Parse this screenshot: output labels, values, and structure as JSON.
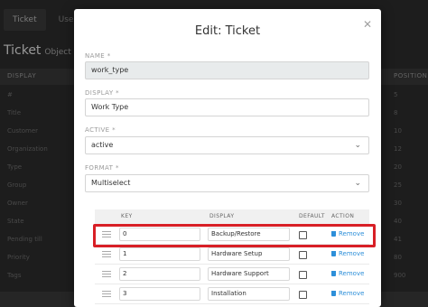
{
  "background": {
    "tabs": [
      "Ticket",
      "User"
    ],
    "title": "Ticket",
    "subtitle": "Object Man",
    "columns": {
      "display": "DISPLAY",
      "position": "POSITION"
    },
    "rows": [
      {
        "name": "#",
        "position": "5"
      },
      {
        "name": "Title",
        "position": "8"
      },
      {
        "name": "Customer",
        "position": "10"
      },
      {
        "name": "Organization",
        "position": "12"
      },
      {
        "name": "Type",
        "position": "20"
      },
      {
        "name": "Group",
        "position": "25"
      },
      {
        "name": "Owner",
        "position": "30"
      },
      {
        "name": "State",
        "position": "40"
      },
      {
        "name": "Pending till",
        "position": "41"
      },
      {
        "name": "Priority",
        "position": "80"
      },
      {
        "name": "Tags",
        "position": "900"
      }
    ]
  },
  "modal": {
    "title": "Edit: Ticket",
    "close_icon": "close-icon",
    "name": {
      "label": "NAME *",
      "value": "work_type"
    },
    "display": {
      "label": "DISPLAY *",
      "value": "Work Type"
    },
    "active": {
      "label": "ACTIVE *",
      "value": "active"
    },
    "format": {
      "label": "FORMAT *",
      "value": "Multiselect"
    },
    "table": {
      "headers": {
        "key": "KEY",
        "display": "DISPLAY",
        "default": "DEFAULT",
        "action": "ACTION"
      },
      "remove_label": "Remove",
      "rows": [
        {
          "key": "0",
          "display": "Backup/Restore"
        },
        {
          "key": "1",
          "display": "Hardware Setup"
        },
        {
          "key": "2",
          "display": "Hardware Support"
        },
        {
          "key": "3",
          "display": "Installation"
        }
      ]
    }
  },
  "colors": {
    "accent": "#2d8fd9",
    "highlight": "#d81f26"
  }
}
